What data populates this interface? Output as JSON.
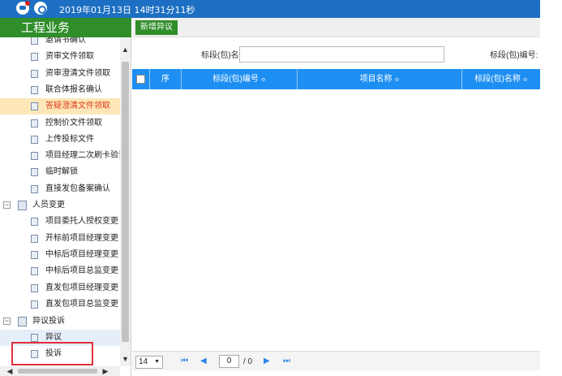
{
  "header": {
    "datetime": "2019年01月13日 14时31分11秒",
    "icons": [
      "message-icon",
      "gear-icon"
    ]
  },
  "sidebar": {
    "title": "工程业务",
    "items": [
      {
        "label": "邀请书确认",
        "type": "leaf"
      },
      {
        "label": "资审文件领取",
        "type": "leaf"
      },
      {
        "label": "资审澄清文件领取",
        "type": "leaf"
      },
      {
        "label": "联合体报名确认",
        "type": "leaf"
      },
      {
        "label": "答疑澄清文件领取",
        "type": "leaf",
        "state": "active"
      },
      {
        "label": "控制价文件领取",
        "type": "leaf"
      },
      {
        "label": "上传投标文件",
        "type": "leaf"
      },
      {
        "label": "项目经理二次刷卡验证",
        "type": "leaf"
      },
      {
        "label": "临时解锁",
        "type": "leaf"
      },
      {
        "label": "直接发包备案确认",
        "type": "leaf"
      },
      {
        "label": "人员变更",
        "type": "group",
        "toggle": "⊟"
      },
      {
        "label": "项目委托人授权变更",
        "type": "leaf"
      },
      {
        "label": "开标前项目经理变更",
        "type": "leaf"
      },
      {
        "label": "中标后项目经理变更",
        "type": "leaf"
      },
      {
        "label": "中标后项目总监变更",
        "type": "leaf"
      },
      {
        "label": "直发包项目经理变更",
        "type": "leaf"
      },
      {
        "label": "直发包项目总监变更",
        "type": "leaf"
      },
      {
        "label": "异议投诉",
        "type": "group",
        "toggle": "⊟"
      },
      {
        "label": "异议",
        "type": "leaf",
        "state": "hover"
      },
      {
        "label": "投诉",
        "type": "leaf"
      }
    ]
  },
  "toolbar": {
    "add_label": "新增异议"
  },
  "search": {
    "package_name_label": "标段(包)名称:",
    "package_name_value": "",
    "package_no_label": "标段(包)编号:"
  },
  "grid": {
    "columns": [
      "序",
      "标段(包)编号",
      "项目名称",
      "标段(包)名称"
    ],
    "sort_glyph": "≎",
    "rows": []
  },
  "pager": {
    "page_size": "14",
    "current_page": "0",
    "total_pages": "/ 0"
  },
  "colors": {
    "header_blue": "#1c6fc2",
    "sidebar_green": "#2f8d2a",
    "grid_header_blue": "#1e8ff2",
    "active_item_text": "#e03a1a",
    "active_item_bg": "#fde7b8",
    "highlight_border": "#e0303a"
  }
}
